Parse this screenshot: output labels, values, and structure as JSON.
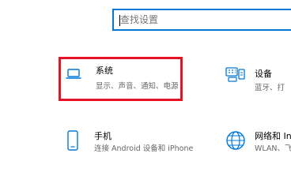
{
  "search": {
    "placeholder": "查找设置",
    "value": ""
  },
  "tiles": [
    {
      "title": "系统",
      "description": "显示、声音、通知、电源",
      "icon": "laptop-icon",
      "highlight_color": "#e81123"
    },
    {
      "title": "设备",
      "description": "蓝牙、打",
      "icon": "keyboard-printer-icon"
    },
    {
      "title": "手机",
      "description": "连接 Android 设备和 iPhone",
      "icon": "phone-icon"
    },
    {
      "title": "网络和 Int",
      "description": "WLAN、飞",
      "icon": "globe-icon"
    }
  ],
  "colors": {
    "accent": "#0078d7",
    "highlight": "#e81123",
    "title": "#000000",
    "description": "#666666"
  }
}
